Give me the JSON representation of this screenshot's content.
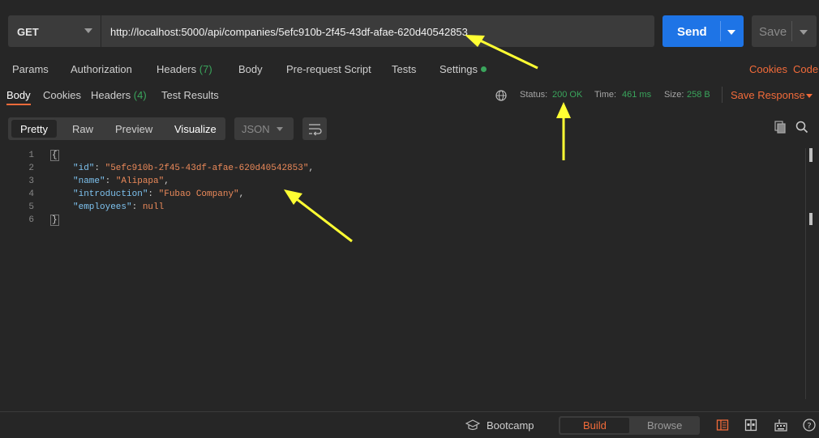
{
  "request": {
    "method": "GET",
    "url": "http://localhost:5000/api/companies/5efc910b-2f45-43df-afae-620d40542853",
    "send_label": "Send",
    "save_label": "Save"
  },
  "request_tabs": {
    "params": "Params",
    "authorization": "Authorization",
    "headers": "Headers",
    "headers_count": "(7)",
    "body": "Body",
    "prerequest": "Pre-request Script",
    "tests": "Tests",
    "settings": "Settings",
    "cookies": "Cookies",
    "code": "Code"
  },
  "response_tabs": {
    "body": "Body",
    "cookies": "Cookies",
    "headers": "Headers",
    "headers_count": "(4)",
    "test_results": "Test Results"
  },
  "response_meta": {
    "status_label": "Status:",
    "status_value": "200 OK",
    "time_label": "Time:",
    "time_value": "461 ms",
    "size_label": "Size:",
    "size_value": "258 B",
    "save_response": "Save Response"
  },
  "view_modes": {
    "pretty": "Pretty",
    "raw": "Raw",
    "preview": "Preview",
    "visualize": "Visualize",
    "format": "JSON"
  },
  "code": {
    "line_numbers": [
      "1",
      "2",
      "3",
      "4",
      "5",
      "6"
    ],
    "open_brace": "{",
    "close_brace": "}",
    "id_key": "\"id\"",
    "id_value": "\"5efc910b-2f45-43df-afae-620d40542853\"",
    "name_key": "\"name\"",
    "name_value": "\"Alipapa\"",
    "intro_key": "\"introduction\"",
    "intro_value": "\"Fubao Company\"",
    "employees_key": "\"employees\"",
    "employees_value": "null"
  },
  "footer": {
    "bootcamp": "Bootcamp",
    "build": "Build",
    "browse": "Browse"
  },
  "colors": {
    "accent_orange": "#f26b3a",
    "send_blue": "#1e74e6",
    "status_green": "#3aa55c",
    "annotation_yellow": "#ffff33"
  }
}
